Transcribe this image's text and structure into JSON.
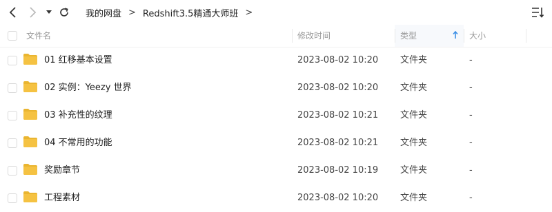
{
  "toolbar": {
    "breadcrumb": [
      "我的网盘",
      "Redshift3.5精通大师班"
    ],
    "separator": ">"
  },
  "columns": {
    "name": "文件名",
    "modified": "修改时间",
    "type": "类型",
    "size": "大小"
  },
  "files": [
    {
      "name": "01 红移基本设置",
      "modified": "2023-08-02 10:20",
      "type": "文件夹",
      "size": "-"
    },
    {
      "name": "02 实例：Yeezy 世界",
      "modified": "2023-08-02 10:20",
      "type": "文件夹",
      "size": "-"
    },
    {
      "name": "03 补充性的纹理",
      "modified": "2023-08-02 10:21",
      "type": "文件夹",
      "size": "-"
    },
    {
      "name": "04 不常用的功能",
      "modified": "2023-08-02 10:21",
      "type": "文件夹",
      "size": "-"
    },
    {
      "name": "奖励章节",
      "modified": "2023-08-02 10:19",
      "type": "文件夹",
      "size": "-"
    },
    {
      "name": "工程素材",
      "modified": "2023-08-02 10:20",
      "type": "文件夹",
      "size": "-"
    }
  ],
  "colors": {
    "folder": "#f5c242",
    "folder_tab": "#eab530",
    "accent": "#3b8fe6"
  }
}
